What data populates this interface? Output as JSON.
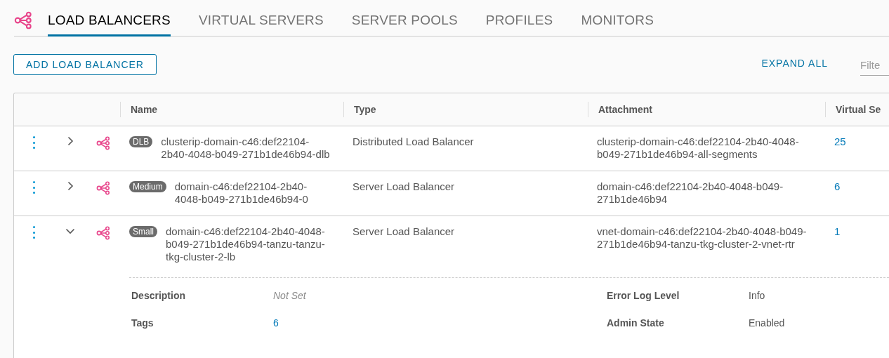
{
  "tabs": [
    {
      "label": "LOAD BALANCERS",
      "selected": true
    },
    {
      "label": "VIRTUAL SERVERS",
      "selected": false
    },
    {
      "label": "SERVER POOLS",
      "selected": false
    },
    {
      "label": "PROFILES",
      "selected": false
    },
    {
      "label": "MONITORS",
      "selected": false
    }
  ],
  "toolbar": {
    "add_button": "ADD LOAD BALANCER",
    "expand_all": "EXPAND ALL",
    "filter": {
      "placeholder": "Filte"
    }
  },
  "table": {
    "columns": [
      "Name",
      "Type",
      "Attachment",
      "Virtual Se"
    ],
    "rows": [
      {
        "expanded": false,
        "badge": "DLB",
        "name": "clusterip-domain-c46:def22104-2b40-4048-b049-271b1de46b94-dlb",
        "type": "Distributed Load Balancer",
        "attachment": "clusterip-domain-c46:def22104-2b40-4048-b049-271b1de46b94-all-segments",
        "virtual_servers": "25"
      },
      {
        "expanded": false,
        "badge": "Medium",
        "name": "domain-c46:def22104-2b40-4048-b049-271b1de46b94-0",
        "type": "Server Load Balancer",
        "attachment": "domain-c46:def22104-2b40-4048-b049-271b1de46b94",
        "virtual_servers": "6"
      },
      {
        "expanded": true,
        "badge": "Small",
        "name": "domain-c46:def22104-2b40-4048-b049-271b1de46b94-tanzu-tanzu-tkg-cluster-2-lb",
        "type": "Server Load Balancer",
        "attachment": "vnet-domain-c46:def22104-2b40-4048-b049-271b1de46b94-tanzu-tkg-cluster-2-vnet-rtr",
        "virtual_servers": "1",
        "details": [
          {
            "label": "Description",
            "value": "Not Set",
            "kind": "unset"
          },
          {
            "label": "Error Log Level",
            "value": "Info",
            "kind": "text"
          },
          {
            "label": "Tags",
            "value": "6",
            "kind": "link"
          },
          {
            "label": "Admin State",
            "value": "Enabled",
            "kind": "text"
          }
        ]
      }
    ]
  }
}
